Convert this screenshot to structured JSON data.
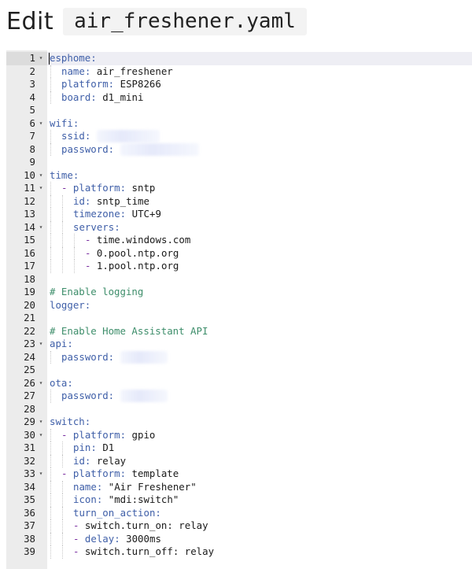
{
  "header": {
    "edit_label": "Edit",
    "filename": "air_freshener.yaml"
  },
  "editor": {
    "cursor_line": 1,
    "lines": [
      {
        "n": "1",
        "fold": true,
        "indent": 0,
        "parts": [
          {
            "t": "esphome:",
            "c": "key"
          }
        ]
      },
      {
        "n": "2",
        "fold": false,
        "indent": 1,
        "parts": [
          {
            "t": "name: ",
            "c": "key"
          },
          {
            "t": "air_freshener",
            "c": "plain"
          }
        ]
      },
      {
        "n": "3",
        "fold": false,
        "indent": 1,
        "parts": [
          {
            "t": "platform: ",
            "c": "key"
          },
          {
            "t": "ESP8266",
            "c": "plain"
          }
        ]
      },
      {
        "n": "4",
        "fold": false,
        "indent": 1,
        "parts": [
          {
            "t": "board: ",
            "c": "key"
          },
          {
            "t": "d1_mini",
            "c": "plain"
          }
        ]
      },
      {
        "n": "5",
        "fold": false,
        "indent": 0,
        "parts": []
      },
      {
        "n": "6",
        "fold": true,
        "indent": 0,
        "parts": [
          {
            "t": "wifi:",
            "c": "key"
          }
        ]
      },
      {
        "n": "7",
        "fold": false,
        "indent": 1,
        "parts": [
          {
            "t": "ssid: ",
            "c": "key"
          }
        ],
        "redacted": true
      },
      {
        "n": "8",
        "fold": false,
        "indent": 1,
        "parts": [
          {
            "t": "password: ",
            "c": "key"
          }
        ],
        "redacted": true
      },
      {
        "n": "9",
        "fold": false,
        "indent": 0,
        "parts": []
      },
      {
        "n": "10",
        "fold": true,
        "indent": 0,
        "parts": [
          {
            "t": "time:",
            "c": "key"
          }
        ]
      },
      {
        "n": "11",
        "fold": true,
        "indent": 1,
        "parts": [
          {
            "t": "- ",
            "c": "dash"
          },
          {
            "t": "platform: ",
            "c": "key"
          },
          {
            "t": "sntp",
            "c": "plain"
          }
        ]
      },
      {
        "n": "12",
        "fold": false,
        "indent": 2,
        "parts": [
          {
            "t": "id: ",
            "c": "key"
          },
          {
            "t": "sntp_time",
            "c": "plain"
          }
        ]
      },
      {
        "n": "13",
        "fold": false,
        "indent": 2,
        "parts": [
          {
            "t": "timezone: ",
            "c": "key"
          },
          {
            "t": "UTC+9",
            "c": "plain"
          }
        ]
      },
      {
        "n": "14",
        "fold": true,
        "indent": 2,
        "parts": [
          {
            "t": "servers:",
            "c": "key"
          }
        ]
      },
      {
        "n": "15",
        "fold": false,
        "indent": 3,
        "parts": [
          {
            "t": "- ",
            "c": "dash"
          },
          {
            "t": "time.windows.com",
            "c": "plain"
          }
        ]
      },
      {
        "n": "16",
        "fold": false,
        "indent": 3,
        "parts": [
          {
            "t": "- ",
            "c": "dash"
          },
          {
            "t": "0.pool.ntp.org",
            "c": "plain"
          }
        ]
      },
      {
        "n": "17",
        "fold": false,
        "indent": 3,
        "parts": [
          {
            "t": "- ",
            "c": "dash"
          },
          {
            "t": "1.pool.ntp.org",
            "c": "plain"
          }
        ]
      },
      {
        "n": "18",
        "fold": false,
        "indent": 0,
        "parts": []
      },
      {
        "n": "19",
        "fold": false,
        "indent": 0,
        "parts": [
          {
            "t": "# Enable logging",
            "c": "comment"
          }
        ]
      },
      {
        "n": "20",
        "fold": false,
        "indent": 0,
        "parts": [
          {
            "t": "logger:",
            "c": "key"
          }
        ]
      },
      {
        "n": "21",
        "fold": false,
        "indent": 0,
        "parts": []
      },
      {
        "n": "22",
        "fold": false,
        "indent": 0,
        "parts": [
          {
            "t": "# Enable Home Assistant API",
            "c": "comment"
          }
        ]
      },
      {
        "n": "23",
        "fold": true,
        "indent": 0,
        "parts": [
          {
            "t": "api:",
            "c": "key"
          }
        ]
      },
      {
        "n": "24",
        "fold": false,
        "indent": 1,
        "parts": [
          {
            "t": "password: ",
            "c": "key"
          }
        ],
        "redacted": true
      },
      {
        "n": "25",
        "fold": false,
        "indent": 0,
        "parts": []
      },
      {
        "n": "26",
        "fold": true,
        "indent": 0,
        "parts": [
          {
            "t": "ota:",
            "c": "key"
          }
        ]
      },
      {
        "n": "27",
        "fold": false,
        "indent": 1,
        "parts": [
          {
            "t": "password: ",
            "c": "key"
          }
        ],
        "redacted": true
      },
      {
        "n": "28",
        "fold": false,
        "indent": 0,
        "parts": []
      },
      {
        "n": "29",
        "fold": true,
        "indent": 0,
        "parts": [
          {
            "t": "switch:",
            "c": "key"
          }
        ]
      },
      {
        "n": "30",
        "fold": true,
        "indent": 1,
        "parts": [
          {
            "t": "- ",
            "c": "dash"
          },
          {
            "t": "platform: ",
            "c": "key"
          },
          {
            "t": "gpio",
            "c": "plain"
          }
        ]
      },
      {
        "n": "31",
        "fold": false,
        "indent": 2,
        "parts": [
          {
            "t": "pin: ",
            "c": "key"
          },
          {
            "t": "D1",
            "c": "plain"
          }
        ]
      },
      {
        "n": "32",
        "fold": false,
        "indent": 2,
        "parts": [
          {
            "t": "id: ",
            "c": "key"
          },
          {
            "t": "relay",
            "c": "plain"
          }
        ]
      },
      {
        "n": "33",
        "fold": true,
        "indent": 1,
        "parts": [
          {
            "t": "- ",
            "c": "dash"
          },
          {
            "t": "platform: ",
            "c": "key"
          },
          {
            "t": "template",
            "c": "plain"
          }
        ]
      },
      {
        "n": "34",
        "fold": false,
        "indent": 2,
        "parts": [
          {
            "t": "name: ",
            "c": "key"
          },
          {
            "t": "\"Air Freshener\"",
            "c": "plain"
          }
        ]
      },
      {
        "n": "35",
        "fold": false,
        "indent": 2,
        "parts": [
          {
            "t": "icon: ",
            "c": "key"
          },
          {
            "t": "\"mdi:switch\"",
            "c": "plain"
          }
        ]
      },
      {
        "n": "36",
        "fold": false,
        "indent": 2,
        "parts": [
          {
            "t": "turn_on_action:",
            "c": "key"
          }
        ]
      },
      {
        "n": "37",
        "fold": false,
        "indent": 2,
        "parts": [
          {
            "t": "- ",
            "c": "dash"
          },
          {
            "t": "switch.turn_on: relay",
            "c": "plain"
          }
        ]
      },
      {
        "n": "38",
        "fold": false,
        "indent": 2,
        "parts": [
          {
            "t": "- ",
            "c": "dash"
          },
          {
            "t": "delay: ",
            "c": "key"
          },
          {
            "t": "3000ms",
            "c": "plain"
          }
        ]
      },
      {
        "n": "39",
        "fold": false,
        "indent": 2,
        "parts": [
          {
            "t": "- ",
            "c": "dash"
          },
          {
            "t": "switch.turn_off: relay",
            "c": "plain"
          }
        ]
      }
    ]
  }
}
